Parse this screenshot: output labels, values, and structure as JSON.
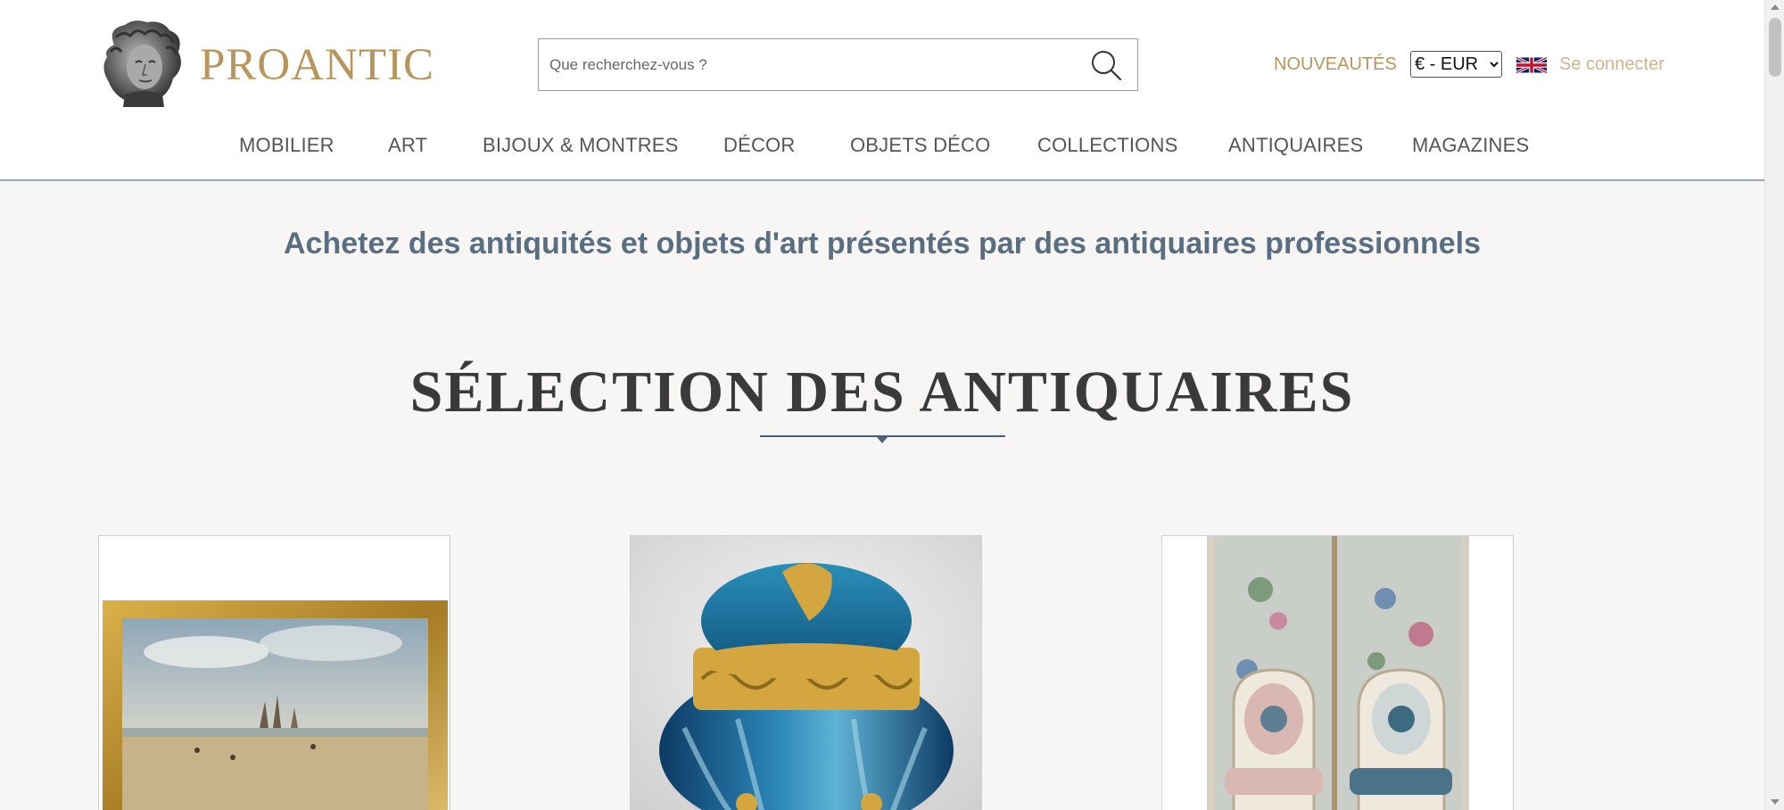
{
  "header": {
    "logo_text": "PROANTIC",
    "logo_icon": "classical-bust-logo",
    "search": {
      "placeholder": "Que recherchez-vous ?",
      "value": "",
      "icon": "search-icon"
    },
    "nouveautes": "NOUVEAUTÉS",
    "currency": {
      "selected": "€ - EUR"
    },
    "language_flag": "uk-flag-icon",
    "login": "Se connecter"
  },
  "nav": {
    "items": [
      {
        "label": "MOBILIER"
      },
      {
        "label": "ART"
      },
      {
        "label": "BIJOUX & MONTRES"
      },
      {
        "label": "DÉCOR"
      },
      {
        "label": "OBJETS DÉCO"
      },
      {
        "label": "COLLECTIONS"
      },
      {
        "label": "ANTIQUAIRES"
      },
      {
        "label": "MAGAZINES"
      }
    ]
  },
  "main": {
    "tagline": "Achetez des antiquités et objets d'art présentés par des antiquaires professionnels",
    "section_title": "SÉLECTION DES ANTIQUAIRES"
  },
  "colors": {
    "brand_gold": "#b8955a",
    "heading_blue": "#5a6e82",
    "background": "#f7f6f4"
  }
}
